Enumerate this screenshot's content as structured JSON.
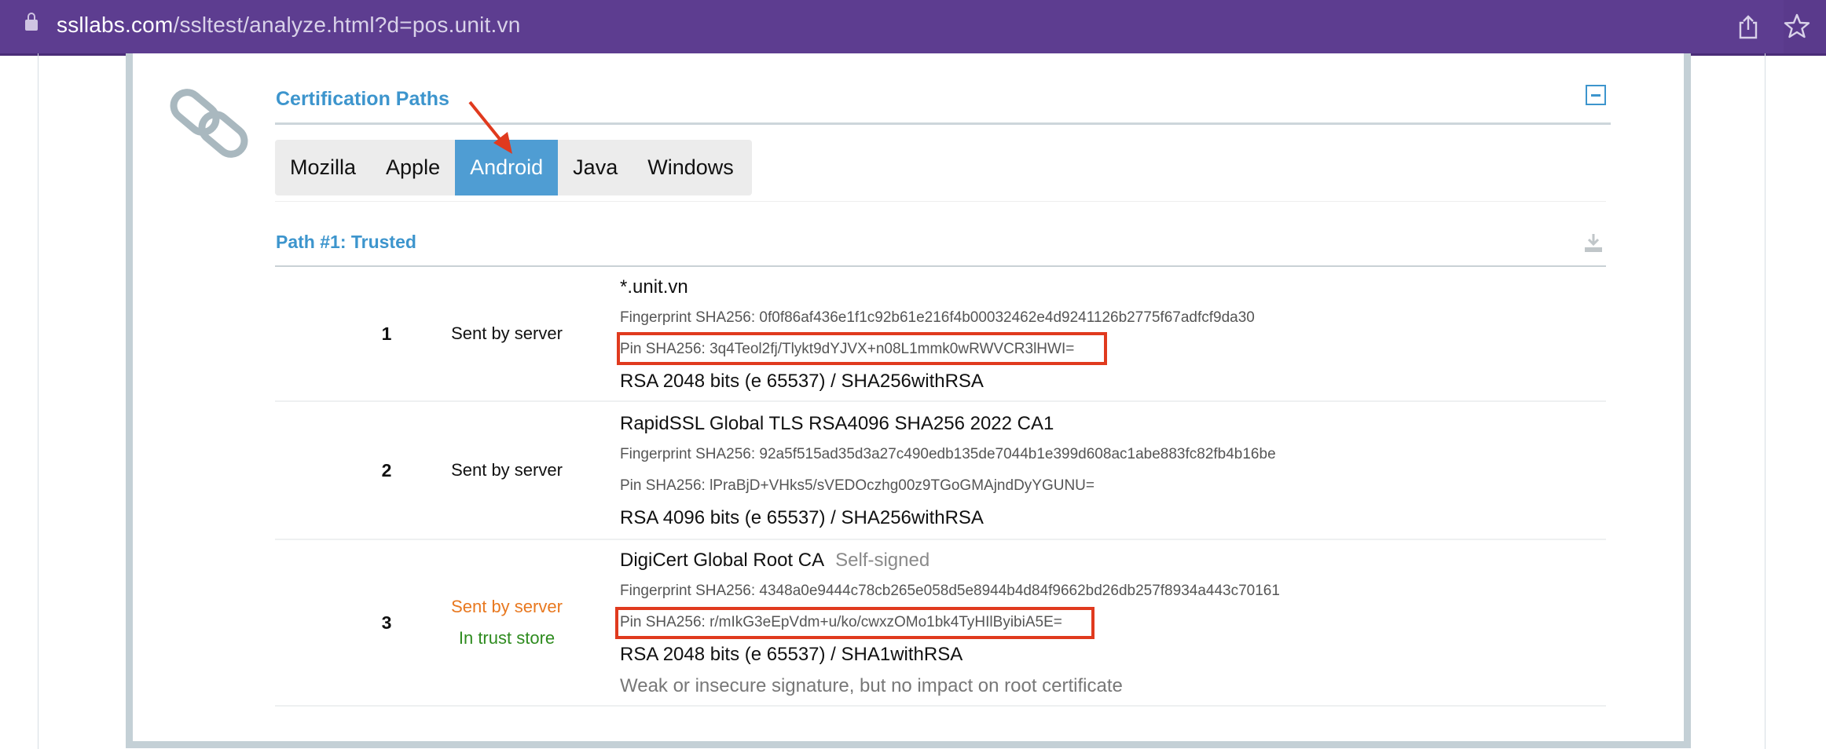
{
  "browser": {
    "url_host": "ssllabs.com",
    "url_path": "/ssltest/analyze.html?d=pos.unit.vn",
    "icons": [
      "lock-icon",
      "share-icon",
      "star-icon"
    ]
  },
  "section": {
    "title": "Certification Paths",
    "icons": [
      "chain-icon",
      "collapse-icon"
    ]
  },
  "tabs": [
    {
      "label": "Mozilla",
      "active": false
    },
    {
      "label": "Apple",
      "active": false
    },
    {
      "label": "Android",
      "active": true
    },
    {
      "label": "Java",
      "active": false
    },
    {
      "label": "Windows",
      "active": false
    }
  ],
  "path": {
    "title": "Path #1: Trusted",
    "icons": [
      "download-icon"
    ]
  },
  "certs": [
    {
      "num": "1",
      "sent": "Sent by server",
      "name": "*.unit.vn",
      "fingerprint": "Fingerprint SHA256: 0f0f86af436e1f1c92b61e216f4b00032462e4d9241126b2775f67adfcf9da30",
      "pin": "Pin SHA256: 3q4Teol2fj/Tlykt9dYJVX+n08L1mmk0wRWVCR3lHWI=",
      "key": "RSA 2048 bits (e 65537) / SHA256withRSA"
    },
    {
      "num": "2",
      "sent": "Sent by server",
      "name": "RapidSSL Global TLS RSA4096 SHA256 2022 CA1",
      "fingerprint": "Fingerprint SHA256: 92a5f515ad35d3a27c490edb135de7044b1e399d608ac1abe883fc82fb4b16be",
      "pin": "Pin SHA256: lPraBjD+VHks5/sVEDOczhg00z9TGoGMAjndDyYGUNU=",
      "key": "RSA 4096 bits (e 65537) / SHA256withRSA"
    },
    {
      "num": "3",
      "sent": "Sent by server",
      "trust": "In trust store",
      "name": "DigiCert Global Root CA",
      "self_signed": "Self-signed",
      "fingerprint": "Fingerprint SHA256: 4348a0e9444c78cb265e058d5e8944b4d84f9662bd26db257f8934a443c70161",
      "pin": "Pin SHA256: r/mIkG3eEpVdm+u/ko/cwxzOMo1bk4TyHIlByibiA5E=",
      "key": "RSA 2048 bits (e 65537) / SHA1withRSA",
      "warning": "Weak or insecure signature, but no impact on root certificate"
    }
  ],
  "colors": {
    "accent": "#3d95cd",
    "active_tab": "#4f9dd3",
    "highlight": "#e03a1e",
    "browser_bar": "#5a3a8c"
  }
}
